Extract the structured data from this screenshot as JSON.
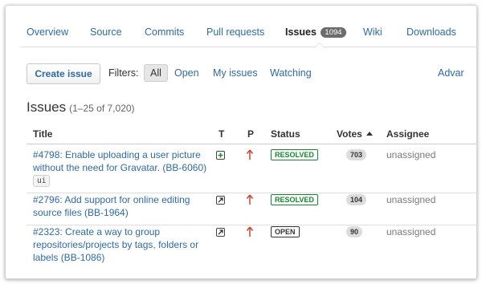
{
  "tabs": [
    {
      "label": "Overview"
    },
    {
      "label": "Source"
    },
    {
      "label": "Commits"
    },
    {
      "label": "Pull requests"
    },
    {
      "label": "Issues",
      "count": "1094",
      "active": true
    },
    {
      "label": "Wiki"
    },
    {
      "label": "Downloads"
    }
  ],
  "toolbar": {
    "create_label": "Create issue",
    "filters_label": "Filters:",
    "filters": [
      {
        "label": "All",
        "active": true
      },
      {
        "label": "Open"
      },
      {
        "label": "My issues"
      },
      {
        "label": "Watching"
      }
    ],
    "advanced_label": "Advar"
  },
  "heading": {
    "title": "Issues",
    "range": "(1–25 of 7,020)"
  },
  "table": {
    "columns": {
      "title": "Title",
      "type": "T",
      "priority": "P",
      "status": "Status",
      "votes": "Votes",
      "assignee": "Assignee"
    },
    "sort_column": "votes",
    "sort_direction": "descending",
    "rows": [
      {
        "title": "#4798: Enable uploading a user picture without the need for Gravatar. (BB-6060)",
        "tag": "ui",
        "type_icon": "plus-square-icon",
        "priority_icon": "arrow-up-icon",
        "status": "RESOLVED",
        "status_kind": "resolved",
        "votes": "703",
        "assignee": "unassigned"
      },
      {
        "title": "#2796: Add support for online editing source files (BB-1964)",
        "tag": "",
        "type_icon": "external-arrow-icon",
        "priority_icon": "arrow-up-icon",
        "status": "RESOLVED",
        "status_kind": "resolved",
        "votes": "104",
        "assignee": "unassigned"
      },
      {
        "title": "#2323: Create a way to group repositories/projects by tags, folders or labels (BB-1086)",
        "tag": "",
        "type_icon": "external-arrow-icon",
        "priority_icon": "arrow-up-icon",
        "status": "OPEN",
        "status_kind": "open",
        "votes": "90",
        "assignee": "unassigned"
      }
    ]
  },
  "colors": {
    "link": "#2e6aa6",
    "resolved": "#14892c",
    "priority": "#d04437"
  }
}
